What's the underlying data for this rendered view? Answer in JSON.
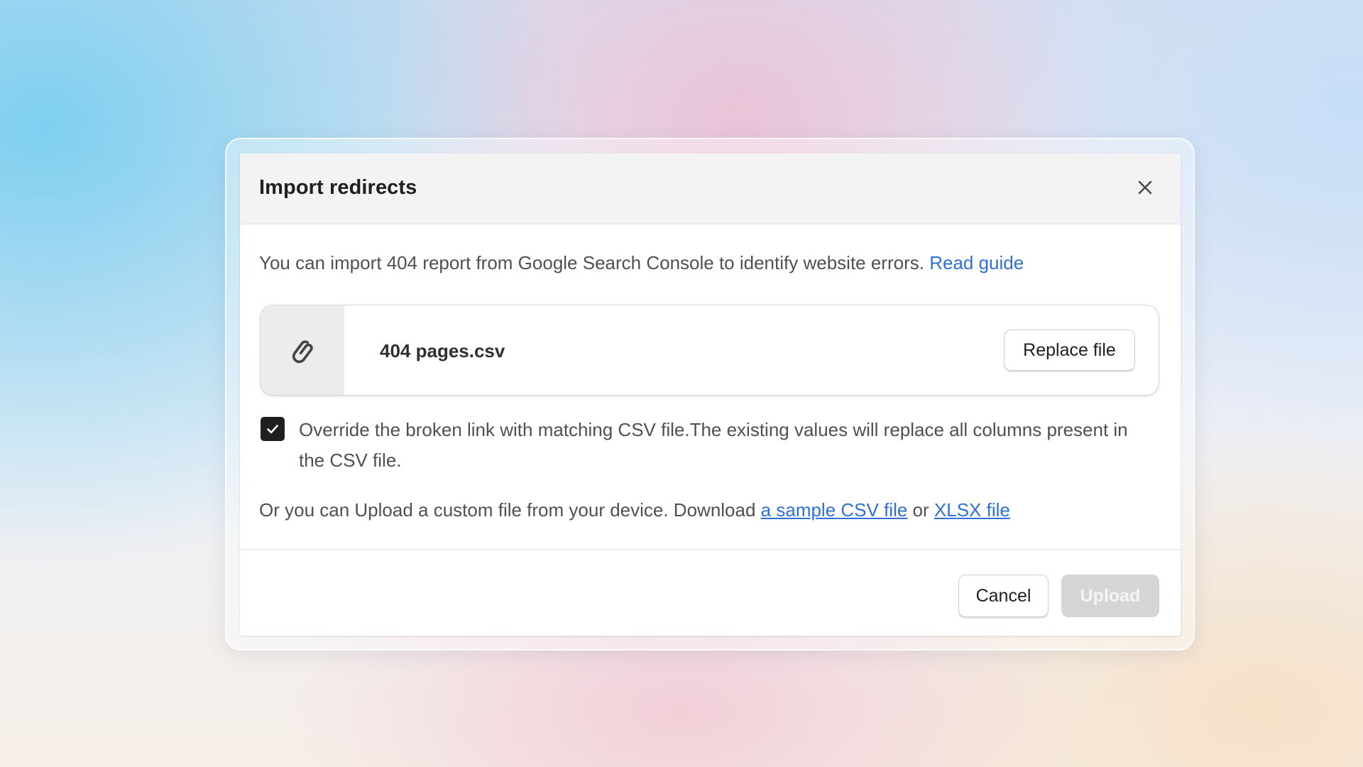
{
  "modal": {
    "title": "Import redirects",
    "close_icon": "close-icon"
  },
  "intro": {
    "text": "You can import 404 report from Google Search Console to identify website errors. ",
    "link": "Read guide"
  },
  "file": {
    "icon": "paperclip-icon",
    "name": "404 pages.csv",
    "replace_label": "Replace file"
  },
  "override": {
    "checked": true,
    "text": "Override the broken link with matching CSV file.The existing values will replace all columns present in the CSV file."
  },
  "custom": {
    "text": "Or you can Upload a custom file from your device. Download ",
    "sample_link": "a sample CSV file",
    "or": " or ",
    "xlsx_link": "XLSX file"
  },
  "footer": {
    "cancel_label": "Cancel",
    "upload_label": "Upload",
    "upload_disabled": true
  },
  "colors": {
    "link": "#2f6fd6",
    "checkbox": "#1f1f1f",
    "disabled_button": "#d5d5d5"
  }
}
